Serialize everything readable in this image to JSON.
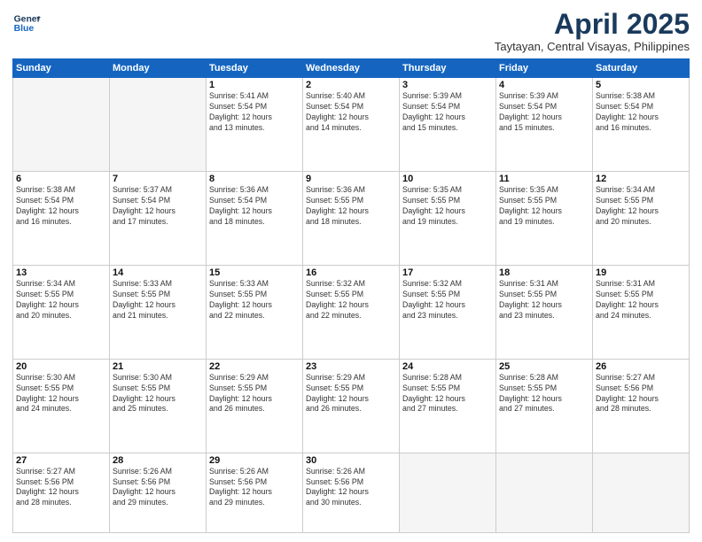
{
  "header": {
    "logo_line1": "General",
    "logo_line2": "Blue",
    "month": "April 2025",
    "location": "Taytayan, Central Visayas, Philippines"
  },
  "weekdays": [
    "Sunday",
    "Monday",
    "Tuesday",
    "Wednesday",
    "Thursday",
    "Friday",
    "Saturday"
  ],
  "weeks": [
    [
      {
        "day": "",
        "info": ""
      },
      {
        "day": "",
        "info": ""
      },
      {
        "day": "1",
        "info": "Sunrise: 5:41 AM\nSunset: 5:54 PM\nDaylight: 12 hours\nand 13 minutes."
      },
      {
        "day": "2",
        "info": "Sunrise: 5:40 AM\nSunset: 5:54 PM\nDaylight: 12 hours\nand 14 minutes."
      },
      {
        "day": "3",
        "info": "Sunrise: 5:39 AM\nSunset: 5:54 PM\nDaylight: 12 hours\nand 15 minutes."
      },
      {
        "day": "4",
        "info": "Sunrise: 5:39 AM\nSunset: 5:54 PM\nDaylight: 12 hours\nand 15 minutes."
      },
      {
        "day": "5",
        "info": "Sunrise: 5:38 AM\nSunset: 5:54 PM\nDaylight: 12 hours\nand 16 minutes."
      }
    ],
    [
      {
        "day": "6",
        "info": "Sunrise: 5:38 AM\nSunset: 5:54 PM\nDaylight: 12 hours\nand 16 minutes."
      },
      {
        "day": "7",
        "info": "Sunrise: 5:37 AM\nSunset: 5:54 PM\nDaylight: 12 hours\nand 17 minutes."
      },
      {
        "day": "8",
        "info": "Sunrise: 5:36 AM\nSunset: 5:54 PM\nDaylight: 12 hours\nand 18 minutes."
      },
      {
        "day": "9",
        "info": "Sunrise: 5:36 AM\nSunset: 5:55 PM\nDaylight: 12 hours\nand 18 minutes."
      },
      {
        "day": "10",
        "info": "Sunrise: 5:35 AM\nSunset: 5:55 PM\nDaylight: 12 hours\nand 19 minutes."
      },
      {
        "day": "11",
        "info": "Sunrise: 5:35 AM\nSunset: 5:55 PM\nDaylight: 12 hours\nand 19 minutes."
      },
      {
        "day": "12",
        "info": "Sunrise: 5:34 AM\nSunset: 5:55 PM\nDaylight: 12 hours\nand 20 minutes."
      }
    ],
    [
      {
        "day": "13",
        "info": "Sunrise: 5:34 AM\nSunset: 5:55 PM\nDaylight: 12 hours\nand 20 minutes."
      },
      {
        "day": "14",
        "info": "Sunrise: 5:33 AM\nSunset: 5:55 PM\nDaylight: 12 hours\nand 21 minutes."
      },
      {
        "day": "15",
        "info": "Sunrise: 5:33 AM\nSunset: 5:55 PM\nDaylight: 12 hours\nand 22 minutes."
      },
      {
        "day": "16",
        "info": "Sunrise: 5:32 AM\nSunset: 5:55 PM\nDaylight: 12 hours\nand 22 minutes."
      },
      {
        "day": "17",
        "info": "Sunrise: 5:32 AM\nSunset: 5:55 PM\nDaylight: 12 hours\nand 23 minutes."
      },
      {
        "day": "18",
        "info": "Sunrise: 5:31 AM\nSunset: 5:55 PM\nDaylight: 12 hours\nand 23 minutes."
      },
      {
        "day": "19",
        "info": "Sunrise: 5:31 AM\nSunset: 5:55 PM\nDaylight: 12 hours\nand 24 minutes."
      }
    ],
    [
      {
        "day": "20",
        "info": "Sunrise: 5:30 AM\nSunset: 5:55 PM\nDaylight: 12 hours\nand 24 minutes."
      },
      {
        "day": "21",
        "info": "Sunrise: 5:30 AM\nSunset: 5:55 PM\nDaylight: 12 hours\nand 25 minutes."
      },
      {
        "day": "22",
        "info": "Sunrise: 5:29 AM\nSunset: 5:55 PM\nDaylight: 12 hours\nand 26 minutes."
      },
      {
        "day": "23",
        "info": "Sunrise: 5:29 AM\nSunset: 5:55 PM\nDaylight: 12 hours\nand 26 minutes."
      },
      {
        "day": "24",
        "info": "Sunrise: 5:28 AM\nSunset: 5:55 PM\nDaylight: 12 hours\nand 27 minutes."
      },
      {
        "day": "25",
        "info": "Sunrise: 5:28 AM\nSunset: 5:55 PM\nDaylight: 12 hours\nand 27 minutes."
      },
      {
        "day": "26",
        "info": "Sunrise: 5:27 AM\nSunset: 5:56 PM\nDaylight: 12 hours\nand 28 minutes."
      }
    ],
    [
      {
        "day": "27",
        "info": "Sunrise: 5:27 AM\nSunset: 5:56 PM\nDaylight: 12 hours\nand 28 minutes."
      },
      {
        "day": "28",
        "info": "Sunrise: 5:26 AM\nSunset: 5:56 PM\nDaylight: 12 hours\nand 29 minutes."
      },
      {
        "day": "29",
        "info": "Sunrise: 5:26 AM\nSunset: 5:56 PM\nDaylight: 12 hours\nand 29 minutes."
      },
      {
        "day": "30",
        "info": "Sunrise: 5:26 AM\nSunset: 5:56 PM\nDaylight: 12 hours\nand 30 minutes."
      },
      {
        "day": "",
        "info": ""
      },
      {
        "day": "",
        "info": ""
      },
      {
        "day": "",
        "info": ""
      }
    ]
  ]
}
